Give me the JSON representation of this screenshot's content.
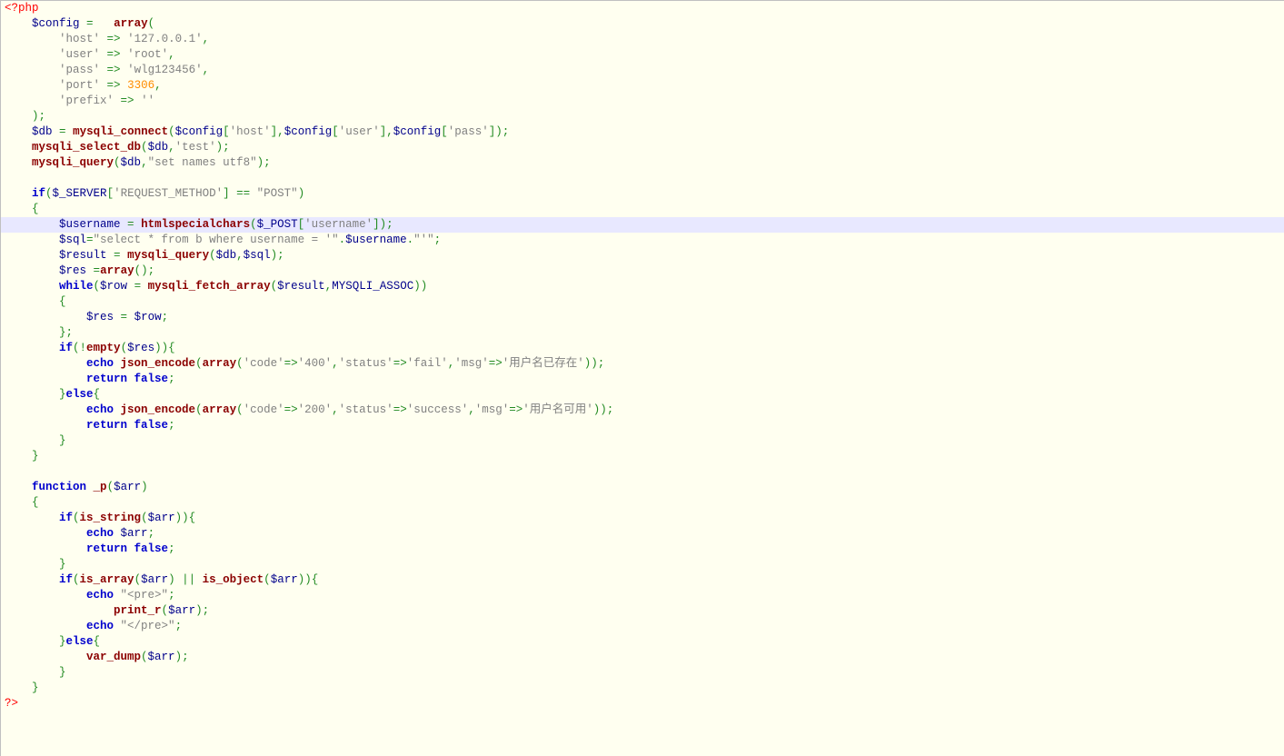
{
  "highlighted_line_index": 14,
  "lines": [
    [
      {
        "t": "<?php",
        "c": "tag"
      }
    ],
    [
      {
        "t": "    ",
        "c": "text"
      },
      {
        "t": "$config",
        "c": "var"
      },
      {
        "t": " ",
        "c": "text"
      },
      {
        "t": "=",
        "c": "op"
      },
      {
        "t": "   ",
        "c": "text"
      },
      {
        "t": "array",
        "c": "func"
      },
      {
        "t": "(",
        "c": "punct"
      }
    ],
    [
      {
        "t": "        ",
        "c": "text"
      },
      {
        "t": "'host'",
        "c": "str"
      },
      {
        "t": " ",
        "c": "text"
      },
      {
        "t": "=>",
        "c": "op"
      },
      {
        "t": " ",
        "c": "text"
      },
      {
        "t": "'127.0.0.1'",
        "c": "str"
      },
      {
        "t": ",",
        "c": "punct"
      }
    ],
    [
      {
        "t": "        ",
        "c": "text"
      },
      {
        "t": "'user'",
        "c": "str"
      },
      {
        "t": " ",
        "c": "text"
      },
      {
        "t": "=>",
        "c": "op"
      },
      {
        "t": " ",
        "c": "text"
      },
      {
        "t": "'root'",
        "c": "str"
      },
      {
        "t": ",",
        "c": "punct"
      }
    ],
    [
      {
        "t": "        ",
        "c": "text"
      },
      {
        "t": "'pass'",
        "c": "str"
      },
      {
        "t": " ",
        "c": "text"
      },
      {
        "t": "=>",
        "c": "op"
      },
      {
        "t": " ",
        "c": "text"
      },
      {
        "t": "'wlg123456'",
        "c": "str"
      },
      {
        "t": ",",
        "c": "punct"
      }
    ],
    [
      {
        "t": "        ",
        "c": "text"
      },
      {
        "t": "'port'",
        "c": "str"
      },
      {
        "t": " ",
        "c": "text"
      },
      {
        "t": "=>",
        "c": "op"
      },
      {
        "t": " ",
        "c": "text"
      },
      {
        "t": "3306",
        "c": "num"
      },
      {
        "t": ",",
        "c": "punct"
      }
    ],
    [
      {
        "t": "        ",
        "c": "text"
      },
      {
        "t": "'prefix'",
        "c": "str"
      },
      {
        "t": " ",
        "c": "text"
      },
      {
        "t": "=>",
        "c": "op"
      },
      {
        "t": " ",
        "c": "text"
      },
      {
        "t": "''",
        "c": "str"
      }
    ],
    [
      {
        "t": "    ",
        "c": "text"
      },
      {
        "t": ");",
        "c": "punct"
      }
    ],
    [
      {
        "t": "    ",
        "c": "text"
      },
      {
        "t": "$db",
        "c": "var"
      },
      {
        "t": " ",
        "c": "text"
      },
      {
        "t": "=",
        "c": "op"
      },
      {
        "t": " ",
        "c": "text"
      },
      {
        "t": "mysqli_connect",
        "c": "func"
      },
      {
        "t": "(",
        "c": "punct"
      },
      {
        "t": "$config",
        "c": "var"
      },
      {
        "t": "[",
        "c": "punct"
      },
      {
        "t": "'host'",
        "c": "str"
      },
      {
        "t": "],",
        "c": "punct"
      },
      {
        "t": "$config",
        "c": "var"
      },
      {
        "t": "[",
        "c": "punct"
      },
      {
        "t": "'user'",
        "c": "str"
      },
      {
        "t": "],",
        "c": "punct"
      },
      {
        "t": "$config",
        "c": "var"
      },
      {
        "t": "[",
        "c": "punct"
      },
      {
        "t": "'pass'",
        "c": "str"
      },
      {
        "t": "]);",
        "c": "punct"
      }
    ],
    [
      {
        "t": "    ",
        "c": "text"
      },
      {
        "t": "mysqli_select_db",
        "c": "func"
      },
      {
        "t": "(",
        "c": "punct"
      },
      {
        "t": "$db",
        "c": "var"
      },
      {
        "t": ",",
        "c": "punct"
      },
      {
        "t": "'test'",
        "c": "str"
      },
      {
        "t": ");",
        "c": "punct"
      }
    ],
    [
      {
        "t": "    ",
        "c": "text"
      },
      {
        "t": "mysqli_query",
        "c": "func"
      },
      {
        "t": "(",
        "c": "punct"
      },
      {
        "t": "$db",
        "c": "var"
      },
      {
        "t": ",",
        "c": "punct"
      },
      {
        "t": "\"set names utf8\"",
        "c": "str"
      },
      {
        "t": ");",
        "c": "punct"
      }
    ],
    [],
    [
      {
        "t": "    ",
        "c": "text"
      },
      {
        "t": "if",
        "c": "keyword"
      },
      {
        "t": "(",
        "c": "punct"
      },
      {
        "t": "$_SERVER",
        "c": "var"
      },
      {
        "t": "[",
        "c": "punct"
      },
      {
        "t": "'REQUEST_METHOD'",
        "c": "str"
      },
      {
        "t": "]",
        "c": "punct"
      },
      {
        "t": " ",
        "c": "text"
      },
      {
        "t": "==",
        "c": "op"
      },
      {
        "t": " ",
        "c": "text"
      },
      {
        "t": "\"POST\"",
        "c": "str"
      },
      {
        "t": ")",
        "c": "punct"
      }
    ],
    [
      {
        "t": "    ",
        "c": "text"
      },
      {
        "t": "{",
        "c": "punct"
      }
    ],
    [
      {
        "t": "        ",
        "c": "text"
      },
      {
        "t": "$username",
        "c": "var"
      },
      {
        "t": " ",
        "c": "text"
      },
      {
        "t": "=",
        "c": "op"
      },
      {
        "t": " ",
        "c": "text"
      },
      {
        "t": "htmlspecialchars",
        "c": "func"
      },
      {
        "t": "(",
        "c": "punct"
      },
      {
        "t": "$_POST",
        "c": "var"
      },
      {
        "t": "[",
        "c": "punct"
      },
      {
        "t": "'username'",
        "c": "str"
      },
      {
        "t": "]);",
        "c": "punct"
      }
    ],
    [
      {
        "t": "        ",
        "c": "text"
      },
      {
        "t": "$sql",
        "c": "var"
      },
      {
        "t": "=",
        "c": "op"
      },
      {
        "t": "\"select * from b where username = '\"",
        "c": "str"
      },
      {
        "t": ".",
        "c": "op"
      },
      {
        "t": "$username",
        "c": "var"
      },
      {
        "t": ".",
        "c": "op"
      },
      {
        "t": "\"'\"",
        "c": "str"
      },
      {
        "t": ";",
        "c": "punct"
      }
    ],
    [
      {
        "t": "        ",
        "c": "text"
      },
      {
        "t": "$result",
        "c": "var"
      },
      {
        "t": " ",
        "c": "text"
      },
      {
        "t": "=",
        "c": "op"
      },
      {
        "t": " ",
        "c": "text"
      },
      {
        "t": "mysqli_query",
        "c": "func"
      },
      {
        "t": "(",
        "c": "punct"
      },
      {
        "t": "$db",
        "c": "var"
      },
      {
        "t": ",",
        "c": "punct"
      },
      {
        "t": "$sql",
        "c": "var"
      },
      {
        "t": ");",
        "c": "punct"
      }
    ],
    [
      {
        "t": "        ",
        "c": "text"
      },
      {
        "t": "$res",
        "c": "var"
      },
      {
        "t": " ",
        "c": "text"
      },
      {
        "t": "=",
        "c": "op"
      },
      {
        "t": "array",
        "c": "func"
      },
      {
        "t": "();",
        "c": "punct"
      }
    ],
    [
      {
        "t": "        ",
        "c": "text"
      },
      {
        "t": "while",
        "c": "keyword"
      },
      {
        "t": "(",
        "c": "punct"
      },
      {
        "t": "$row",
        "c": "var"
      },
      {
        "t": " ",
        "c": "text"
      },
      {
        "t": "=",
        "c": "op"
      },
      {
        "t": " ",
        "c": "text"
      },
      {
        "t": "mysqli_fetch_array",
        "c": "func"
      },
      {
        "t": "(",
        "c": "punct"
      },
      {
        "t": "$result",
        "c": "var"
      },
      {
        "t": ",",
        "c": "punct"
      },
      {
        "t": "MYSQLI_ASSOC",
        "c": "var"
      },
      {
        "t": "))",
        "c": "punct"
      }
    ],
    [
      {
        "t": "        ",
        "c": "text"
      },
      {
        "t": "{",
        "c": "punct"
      }
    ],
    [
      {
        "t": "            ",
        "c": "text"
      },
      {
        "t": "$res",
        "c": "var"
      },
      {
        "t": " ",
        "c": "text"
      },
      {
        "t": "=",
        "c": "op"
      },
      {
        "t": " ",
        "c": "text"
      },
      {
        "t": "$row",
        "c": "var"
      },
      {
        "t": ";",
        "c": "punct"
      }
    ],
    [
      {
        "t": "        ",
        "c": "text"
      },
      {
        "t": "};",
        "c": "punct"
      }
    ],
    [
      {
        "t": "        ",
        "c": "text"
      },
      {
        "t": "if",
        "c": "keyword"
      },
      {
        "t": "(!",
        "c": "punct"
      },
      {
        "t": "empty",
        "c": "func"
      },
      {
        "t": "(",
        "c": "punct"
      },
      {
        "t": "$res",
        "c": "var"
      },
      {
        "t": ")){",
        "c": "punct"
      }
    ],
    [
      {
        "t": "            ",
        "c": "text"
      },
      {
        "t": "echo",
        "c": "keyword"
      },
      {
        "t": " ",
        "c": "text"
      },
      {
        "t": "json_encode",
        "c": "func"
      },
      {
        "t": "(",
        "c": "punct"
      },
      {
        "t": "array",
        "c": "func"
      },
      {
        "t": "(",
        "c": "punct"
      },
      {
        "t": "'code'",
        "c": "str"
      },
      {
        "t": "=>",
        "c": "op"
      },
      {
        "t": "'400'",
        "c": "str"
      },
      {
        "t": ",",
        "c": "punct"
      },
      {
        "t": "'status'",
        "c": "str"
      },
      {
        "t": "=>",
        "c": "op"
      },
      {
        "t": "'fail'",
        "c": "str"
      },
      {
        "t": ",",
        "c": "punct"
      },
      {
        "t": "'msg'",
        "c": "str"
      },
      {
        "t": "=>",
        "c": "op"
      },
      {
        "t": "'用户名已存在'",
        "c": "str"
      },
      {
        "t": "));",
        "c": "punct"
      }
    ],
    [
      {
        "t": "            ",
        "c": "text"
      },
      {
        "t": "return",
        "c": "keyword"
      },
      {
        "t": " ",
        "c": "text"
      },
      {
        "t": "false",
        "c": "keyword"
      },
      {
        "t": ";",
        "c": "punct"
      }
    ],
    [
      {
        "t": "        ",
        "c": "text"
      },
      {
        "t": "}",
        "c": "punct"
      },
      {
        "t": "else",
        "c": "keyword"
      },
      {
        "t": "{",
        "c": "punct"
      }
    ],
    [
      {
        "t": "            ",
        "c": "text"
      },
      {
        "t": "echo",
        "c": "keyword"
      },
      {
        "t": " ",
        "c": "text"
      },
      {
        "t": "json_encode",
        "c": "func"
      },
      {
        "t": "(",
        "c": "punct"
      },
      {
        "t": "array",
        "c": "func"
      },
      {
        "t": "(",
        "c": "punct"
      },
      {
        "t": "'code'",
        "c": "str"
      },
      {
        "t": "=>",
        "c": "op"
      },
      {
        "t": "'200'",
        "c": "str"
      },
      {
        "t": ",",
        "c": "punct"
      },
      {
        "t": "'status'",
        "c": "str"
      },
      {
        "t": "=>",
        "c": "op"
      },
      {
        "t": "'success'",
        "c": "str"
      },
      {
        "t": ",",
        "c": "punct"
      },
      {
        "t": "'msg'",
        "c": "str"
      },
      {
        "t": "=>",
        "c": "op"
      },
      {
        "t": "'用户名可用'",
        "c": "str"
      },
      {
        "t": "));",
        "c": "punct"
      }
    ],
    [
      {
        "t": "            ",
        "c": "text"
      },
      {
        "t": "return",
        "c": "keyword"
      },
      {
        "t": " ",
        "c": "text"
      },
      {
        "t": "false",
        "c": "keyword"
      },
      {
        "t": ";",
        "c": "punct"
      }
    ],
    [
      {
        "t": "        ",
        "c": "text"
      },
      {
        "t": "}",
        "c": "punct"
      }
    ],
    [
      {
        "t": "    ",
        "c": "text"
      },
      {
        "t": "}",
        "c": "punct"
      }
    ],
    [],
    [
      {
        "t": "    ",
        "c": "text"
      },
      {
        "t": "function",
        "c": "keyword"
      },
      {
        "t": " ",
        "c": "text"
      },
      {
        "t": "_p",
        "c": "func"
      },
      {
        "t": "(",
        "c": "punct"
      },
      {
        "t": "$arr",
        "c": "var"
      },
      {
        "t": ")",
        "c": "punct"
      }
    ],
    [
      {
        "t": "    ",
        "c": "text"
      },
      {
        "t": "{",
        "c": "punct"
      }
    ],
    [
      {
        "t": "        ",
        "c": "text"
      },
      {
        "t": "if",
        "c": "keyword"
      },
      {
        "t": "(",
        "c": "punct"
      },
      {
        "t": "is_string",
        "c": "func"
      },
      {
        "t": "(",
        "c": "punct"
      },
      {
        "t": "$arr",
        "c": "var"
      },
      {
        "t": ")){",
        "c": "punct"
      }
    ],
    [
      {
        "t": "            ",
        "c": "text"
      },
      {
        "t": "echo",
        "c": "keyword"
      },
      {
        "t": " ",
        "c": "text"
      },
      {
        "t": "$arr",
        "c": "var"
      },
      {
        "t": ";",
        "c": "punct"
      }
    ],
    [
      {
        "t": "            ",
        "c": "text"
      },
      {
        "t": "return",
        "c": "keyword"
      },
      {
        "t": " ",
        "c": "text"
      },
      {
        "t": "false",
        "c": "keyword"
      },
      {
        "t": ";",
        "c": "punct"
      }
    ],
    [
      {
        "t": "        ",
        "c": "text"
      },
      {
        "t": "}",
        "c": "punct"
      }
    ],
    [
      {
        "t": "        ",
        "c": "text"
      },
      {
        "t": "if",
        "c": "keyword"
      },
      {
        "t": "(",
        "c": "punct"
      },
      {
        "t": "is_array",
        "c": "func"
      },
      {
        "t": "(",
        "c": "punct"
      },
      {
        "t": "$arr",
        "c": "var"
      },
      {
        "t": ")",
        "c": "punct"
      },
      {
        "t": " ",
        "c": "text"
      },
      {
        "t": "||",
        "c": "op"
      },
      {
        "t": " ",
        "c": "text"
      },
      {
        "t": "is_object",
        "c": "func"
      },
      {
        "t": "(",
        "c": "punct"
      },
      {
        "t": "$arr",
        "c": "var"
      },
      {
        "t": ")){",
        "c": "punct"
      }
    ],
    [
      {
        "t": "            ",
        "c": "text"
      },
      {
        "t": "echo",
        "c": "keyword"
      },
      {
        "t": " ",
        "c": "text"
      },
      {
        "t": "\"<pre>\"",
        "c": "str"
      },
      {
        "t": ";",
        "c": "punct"
      }
    ],
    [
      {
        "t": "                ",
        "c": "text"
      },
      {
        "t": "print_r",
        "c": "func"
      },
      {
        "t": "(",
        "c": "punct"
      },
      {
        "t": "$arr",
        "c": "var"
      },
      {
        "t": ");",
        "c": "punct"
      }
    ],
    [
      {
        "t": "            ",
        "c": "text"
      },
      {
        "t": "echo",
        "c": "keyword"
      },
      {
        "t": " ",
        "c": "text"
      },
      {
        "t": "\"</pre>\"",
        "c": "str"
      },
      {
        "t": ";",
        "c": "punct"
      }
    ],
    [
      {
        "t": "        ",
        "c": "text"
      },
      {
        "t": "}",
        "c": "punct"
      },
      {
        "t": "else",
        "c": "keyword"
      },
      {
        "t": "{",
        "c": "punct"
      }
    ],
    [
      {
        "t": "            ",
        "c": "text"
      },
      {
        "t": "var_dump",
        "c": "func"
      },
      {
        "t": "(",
        "c": "punct"
      },
      {
        "t": "$arr",
        "c": "var"
      },
      {
        "t": ");",
        "c": "punct"
      }
    ],
    [
      {
        "t": "        ",
        "c": "text"
      },
      {
        "t": "}",
        "c": "punct"
      }
    ],
    [
      {
        "t": "    ",
        "c": "text"
      },
      {
        "t": "}",
        "c": "punct"
      }
    ],
    [
      {
        "t": "?>",
        "c": "tag"
      }
    ]
  ]
}
